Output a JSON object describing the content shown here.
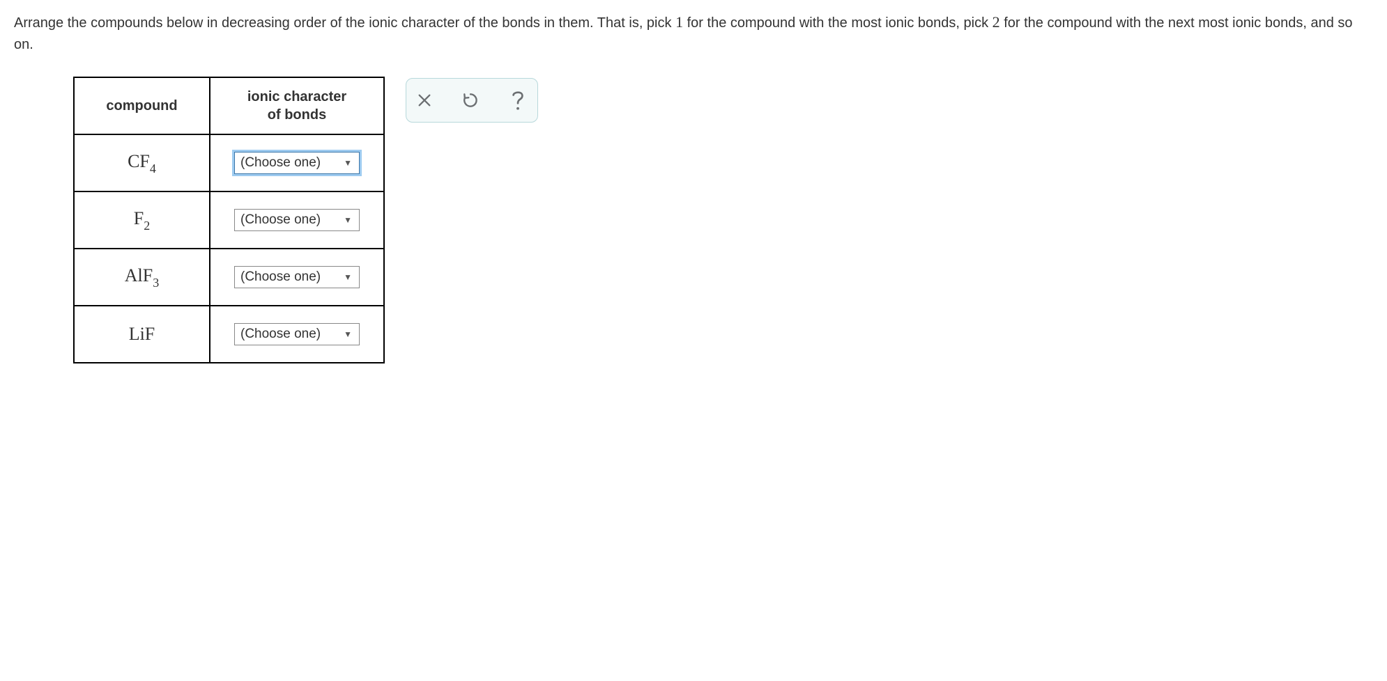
{
  "instructions": {
    "part1": "Arrange the compounds below in decreasing order of the ionic character of the bonds in them. That is, pick ",
    "num1": "1",
    "part2": " for the compound with the most ionic bonds, pick ",
    "num2": "2",
    "part3": " for the compound with the next most ionic bonds, and so on."
  },
  "table": {
    "header_compound": "compound",
    "header_ionic_line1": "ionic character",
    "header_ionic_line2": "of bonds",
    "placeholder": "(Choose one)",
    "rows": [
      {
        "base": "CF",
        "sub": "4",
        "focused": true
      },
      {
        "base": "F",
        "sub": "2",
        "focused": false
      },
      {
        "base": "AlF",
        "sub": "3",
        "focused": false
      },
      {
        "base": "LiF",
        "sub": "",
        "focused": false
      }
    ]
  }
}
